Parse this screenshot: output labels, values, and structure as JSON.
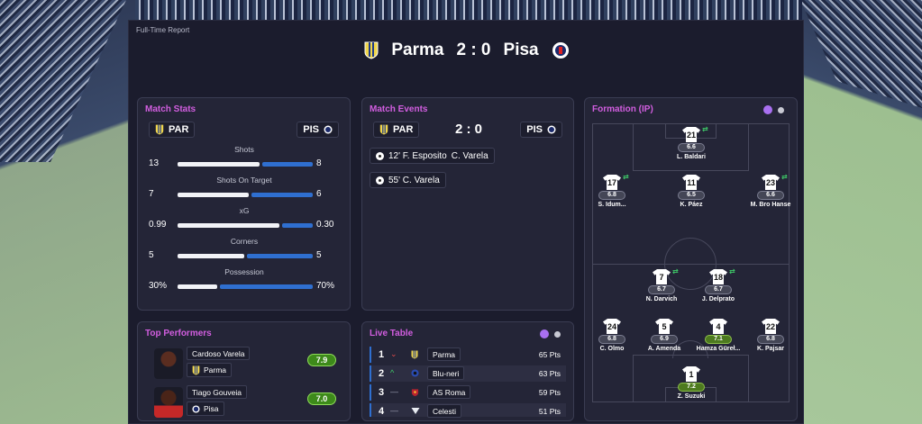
{
  "report": {
    "title": "Full-Time Report",
    "home": "Parma",
    "score": "2 : 0",
    "away": "Pisa"
  },
  "colors": {
    "accent": "#d25ee0",
    "bar_home": "#f2f3f7",
    "bar_away": "#2f6fd0",
    "rating_good": "#3d8a1a",
    "dot_active": "#a970f0"
  },
  "match_stats": {
    "title": "Match Stats",
    "home_abbr": "PAR",
    "away_abbr": "PIS",
    "rows": [
      {
        "label": "Shots",
        "home": "13",
        "away": "8",
        "home_share": 0.62
      },
      {
        "label": "Shots On Target",
        "home": "7",
        "away": "6",
        "home_share": 0.54
      },
      {
        "label": "xG",
        "home": "0.99",
        "away": "0.30",
        "home_share": 0.77
      },
      {
        "label": "Corners",
        "home": "5",
        "away": "5",
        "home_share": 0.5
      },
      {
        "label": "Possession",
        "home": "30%",
        "away": "70%",
        "home_share": 0.3
      }
    ]
  },
  "match_events": {
    "title": "Match Events",
    "home_abbr": "PAR",
    "away_abbr": "PIS",
    "score": "2 : 0",
    "events": [
      {
        "text": "12' F. Esposito",
        "assist": "C. Varela"
      },
      {
        "text": "55' C. Varela",
        "assist": ""
      }
    ]
  },
  "formation": {
    "title": "Formation (IP)",
    "players": [
      {
        "number": "21",
        "rating": "6.6",
        "name": "L. Baldari",
        "sub": true,
        "good": false
      },
      {
        "number": "17",
        "rating": "6.8",
        "name": "S. Idum...",
        "sub": true,
        "good": false
      },
      {
        "number": "11",
        "rating": "6.5",
        "name": "K. Páez",
        "sub": false,
        "good": false
      },
      {
        "number": "23",
        "rating": "6.6",
        "name": "M. Bro Hanse",
        "sub": true,
        "good": false
      },
      {
        "number": "7",
        "rating": "6.7",
        "name": "N. Darvich",
        "sub": true,
        "good": false
      },
      {
        "number": "18",
        "rating": "6.7",
        "name": "J. Delprato",
        "sub": true,
        "good": false
      },
      {
        "number": "24",
        "rating": "6.8",
        "name": "C. Olmo",
        "sub": false,
        "good": false
      },
      {
        "number": "5",
        "rating": "6.9",
        "name": "A. Amenda",
        "sub": false,
        "good": false
      },
      {
        "number": "4",
        "rating": "7.1",
        "name": "Hamza Güreł...",
        "sub": false,
        "good": true
      },
      {
        "number": "22",
        "rating": "6.8",
        "name": "K. Pajsar",
        "sub": false,
        "good": false
      },
      {
        "number": "1",
        "rating": "7.2",
        "name": "Z. Suzuki",
        "sub": false,
        "good": true
      }
    ]
  },
  "top_performers": {
    "title": "Top Performers",
    "items": [
      {
        "name": "Cardoso Varela",
        "team": "Parma",
        "rating": "7.9"
      },
      {
        "name": "Tiago Gouveia",
        "team": "Pisa",
        "rating": "7.0"
      }
    ]
  },
  "live_table": {
    "title": "Live Table",
    "rows": [
      {
        "pos": "1",
        "move": "⌄",
        "team": "Parma",
        "pts": "65 Pts"
      },
      {
        "pos": "2",
        "move": "^",
        "team": "Blu-neri",
        "pts": "63 Pts"
      },
      {
        "pos": "3",
        "move": "—",
        "team": "AS Roma",
        "pts": "59 Pts"
      },
      {
        "pos": "4",
        "move": "—",
        "team": "Celesti",
        "pts": "51 Pts"
      }
    ]
  }
}
